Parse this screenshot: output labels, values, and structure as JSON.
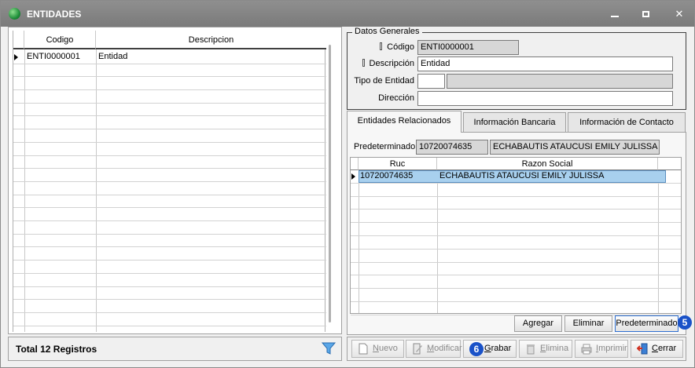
{
  "window": {
    "title": "ENTIDADES"
  },
  "grid": {
    "columns": [
      "Codigo",
      "Descripcion"
    ],
    "rows": [
      {
        "codigo": "ENTI0000001",
        "descripcion": "Entidad"
      }
    ]
  },
  "footer": {
    "total": "Total 12 Registros"
  },
  "datos_generales": {
    "legend": "Datos Generales",
    "codigo_label": "Código",
    "codigo_value": "ENTI0000001",
    "descripcion_label": "Descripción",
    "descripcion_value": "Entidad",
    "tipo_label": "Tipo de Entidad",
    "tipo_value": "",
    "tipo_desc": "",
    "direccion_label": "Dirección",
    "direccion_value": ""
  },
  "tabs": [
    {
      "label": "Entidades Relacionados",
      "active": true
    },
    {
      "label": "Información Bancaria",
      "active": false
    },
    {
      "label": "Información de Contacto",
      "active": false
    }
  ],
  "relacionados": {
    "predeterminado_label": "Predeterminado",
    "predeterminado_ruc": "10720074635",
    "predeterminado_nombre": "ECHABAUTIS ATAUCUSI EMILY JULISSA",
    "columns": [
      "Ruc",
      "Razon Social"
    ],
    "rows": [
      {
        "ruc": "10720074635",
        "razon": "ECHABAUTIS ATAUCUSI EMILY JULISSA"
      }
    ],
    "buttons": {
      "agregar": "Agregar",
      "eliminar": "Eliminar",
      "predeterminado": "Predeterminado"
    },
    "badge": "5"
  },
  "toolbar": {
    "nuevo_first": "N",
    "nuevo_rest": "uevo",
    "modificar_first": "M",
    "modificar_rest": "odificar",
    "grabar_first": "G",
    "grabar_rest": "rabar",
    "elimina_first": "E",
    "elimina_rest": "limina",
    "imprimir_first": "I",
    "imprimir_rest": "mprimir",
    "cerrar_first": "C",
    "cerrar_rest": "errar",
    "badge": "6"
  },
  "colors": {
    "titlebar": "#858585",
    "selection": "#a8d0ee",
    "badge": "#1a52c8"
  }
}
